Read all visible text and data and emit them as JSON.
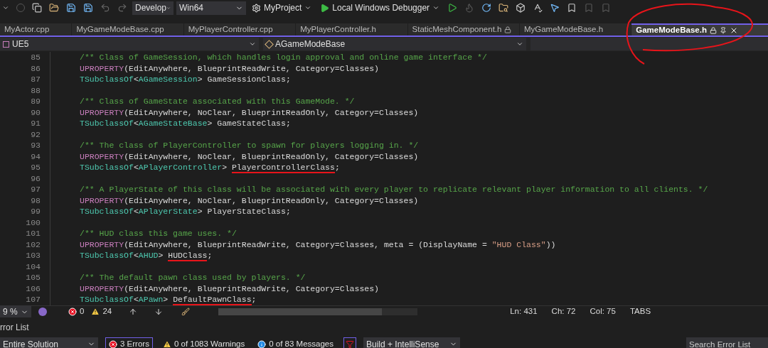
{
  "toolbar": {
    "configuration": "Develop",
    "platform": "Win64",
    "startup_project": "MyProject",
    "debugger": "Local Windows Debugger"
  },
  "tabs": [
    {
      "label": "MyActor.cpp",
      "selected": false,
      "locked": false
    },
    {
      "label": "MyGameModeBase.cpp",
      "selected": false,
      "locked": false
    },
    {
      "label": "MyPlayerController.cpp",
      "selected": false,
      "locked": false
    },
    {
      "label": "MyPlayerController.h",
      "selected": false,
      "locked": false
    },
    {
      "label": "StaticMeshComponent.h",
      "selected": false,
      "locked": true
    },
    {
      "label": "MyGameModeBase.h",
      "selected": false,
      "locked": false
    },
    {
      "label": "GameModeBase.h",
      "selected": true,
      "locked": true
    }
  ],
  "nav_bar": {
    "project": "UE5",
    "scope": "AGameModeBase"
  },
  "code_lines": [
    {
      "number": "85",
      "tokens": [
        {
          "kind": "comment",
          "text": "/** Class of GameSession, which handles login approval and online game interface */"
        }
      ]
    },
    {
      "number": "86",
      "tokens": [
        {
          "kind": "macro",
          "text": "UPROPERTY"
        },
        {
          "kind": "plain",
          "text": "(EditAnywhere, BlueprintReadWrite, Category=Classes)"
        }
      ]
    },
    {
      "number": "87",
      "tokens": [
        {
          "kind": "type",
          "text": "TSubclassOf"
        },
        {
          "kind": "plain",
          "text": "<"
        },
        {
          "kind": "type",
          "text": "AGameSession"
        },
        {
          "kind": "plain",
          "text": "> "
        },
        {
          "kind": "member",
          "text": "GameSessionClass",
          "underlined": false
        },
        {
          "kind": "plain",
          "text": ";"
        }
      ]
    },
    {
      "number": "88"
    },
    {
      "number": "89",
      "tokens": [
        {
          "kind": "comment",
          "text": "/** Class of GameState associated with this GameMode. */"
        }
      ]
    },
    {
      "number": "90",
      "tokens": [
        {
          "kind": "macro",
          "text": "UPROPERTY"
        },
        {
          "kind": "plain",
          "text": "(EditAnywhere, NoClear, BlueprintReadOnly, Category=Classes)"
        }
      ]
    },
    {
      "number": "91",
      "tokens": [
        {
          "kind": "type",
          "text": "TSubclassOf"
        },
        {
          "kind": "plain",
          "text": "<"
        },
        {
          "kind": "type",
          "text": "AGameStateBase"
        },
        {
          "kind": "plain",
          "text": "> "
        },
        {
          "kind": "member",
          "text": "GameStateClass",
          "underlined": false
        },
        {
          "kind": "plain",
          "text": ";"
        }
      ]
    },
    {
      "number": "92"
    },
    {
      "number": "93",
      "tokens": [
        {
          "kind": "comment",
          "text": "/** The class of PlayerController to spawn for players logging in. */"
        }
      ]
    },
    {
      "number": "94",
      "tokens": [
        {
          "kind": "macro",
          "text": "UPROPERTY"
        },
        {
          "kind": "plain",
          "text": "(EditAnywhere, NoClear, BlueprintReadOnly, Category=Classes)"
        }
      ]
    },
    {
      "number": "95",
      "tokens": [
        {
          "kind": "type",
          "text": "TSubclassOf"
        },
        {
          "kind": "plain",
          "text": "<"
        },
        {
          "kind": "type",
          "text": "APlayerController"
        },
        {
          "kind": "plain",
          "text": "> "
        },
        {
          "kind": "member",
          "text": "PlayerControllerClass",
          "underlined": true
        },
        {
          "kind": "plain",
          "text": ";"
        }
      ]
    },
    {
      "number": "96"
    },
    {
      "number": "97",
      "tokens": [
        {
          "kind": "comment",
          "text": "/** A PlayerState of this class will be associated with every player to replicate relevant player information to all clients. */"
        }
      ]
    },
    {
      "number": "98",
      "tokens": [
        {
          "kind": "macro",
          "text": "UPROPERTY"
        },
        {
          "kind": "plain",
          "text": "(EditAnywhere, NoClear, BlueprintReadOnly, Category=Classes)"
        }
      ]
    },
    {
      "number": "99",
      "tokens": [
        {
          "kind": "type",
          "text": "TSubclassOf"
        },
        {
          "kind": "plain",
          "text": "<"
        },
        {
          "kind": "type",
          "text": "APlayerState"
        },
        {
          "kind": "plain",
          "text": "> "
        },
        {
          "kind": "member",
          "text": "PlayerStateClass",
          "underlined": false
        },
        {
          "kind": "plain",
          "text": ";"
        }
      ]
    },
    {
      "number": "100"
    },
    {
      "number": "101",
      "tokens": [
        {
          "kind": "comment",
          "text": "/** HUD class this game uses. */"
        }
      ]
    },
    {
      "number": "102",
      "tokens": [
        {
          "kind": "macro",
          "text": "UPROPERTY"
        },
        {
          "kind": "plain",
          "text": "(EditAnywhere, BlueprintReadWrite, Category=Classes, meta = (DisplayName = "
        },
        {
          "kind": "string",
          "text": "\"HUD Class\""
        },
        {
          "kind": "plain",
          "text": "))"
        }
      ]
    },
    {
      "number": "103",
      "tokens": [
        {
          "kind": "type",
          "text": "TSubclassOf"
        },
        {
          "kind": "plain",
          "text": "<"
        },
        {
          "kind": "type",
          "text": "AHUD"
        },
        {
          "kind": "plain",
          "text": "> "
        },
        {
          "kind": "member",
          "text": "HUDClass",
          "underlined": true
        },
        {
          "kind": "plain",
          "text": ";"
        }
      ]
    },
    {
      "number": "104"
    },
    {
      "number": "105",
      "tokens": [
        {
          "kind": "comment",
          "text": "/** The default pawn class used by players. */"
        }
      ]
    },
    {
      "number": "106",
      "tokens": [
        {
          "kind": "macro",
          "text": "UPROPERTY"
        },
        {
          "kind": "plain",
          "text": "(EditAnywhere, BlueprintReadWrite, Category=Classes)"
        }
      ]
    },
    {
      "number": "107",
      "tokens": [
        {
          "kind": "type",
          "text": "TSubclassOf"
        },
        {
          "kind": "plain",
          "text": "<"
        },
        {
          "kind": "type",
          "text": "APawn"
        },
        {
          "kind": "plain",
          "text": "> "
        },
        {
          "kind": "member",
          "text": "DefaultPawnClass",
          "underlined": true
        },
        {
          "kind": "plain",
          "text": ";"
        }
      ]
    }
  ],
  "status_bar": {
    "zoom": "9 %",
    "errors": "0",
    "warnings": "24",
    "line": "Ln: 431",
    "char": "Ch: 72",
    "column": "Col: 75",
    "indent": "TABS"
  },
  "error_list": {
    "title": "rror List",
    "scope": "Entire Solution",
    "errors": "3 Errors",
    "warnings": "0 of 1083 Warnings",
    "messages": "0 of 83 Messages",
    "source": "Build + IntelliSense",
    "search": {
      "placeholder": "Search Error List"
    }
  }
}
